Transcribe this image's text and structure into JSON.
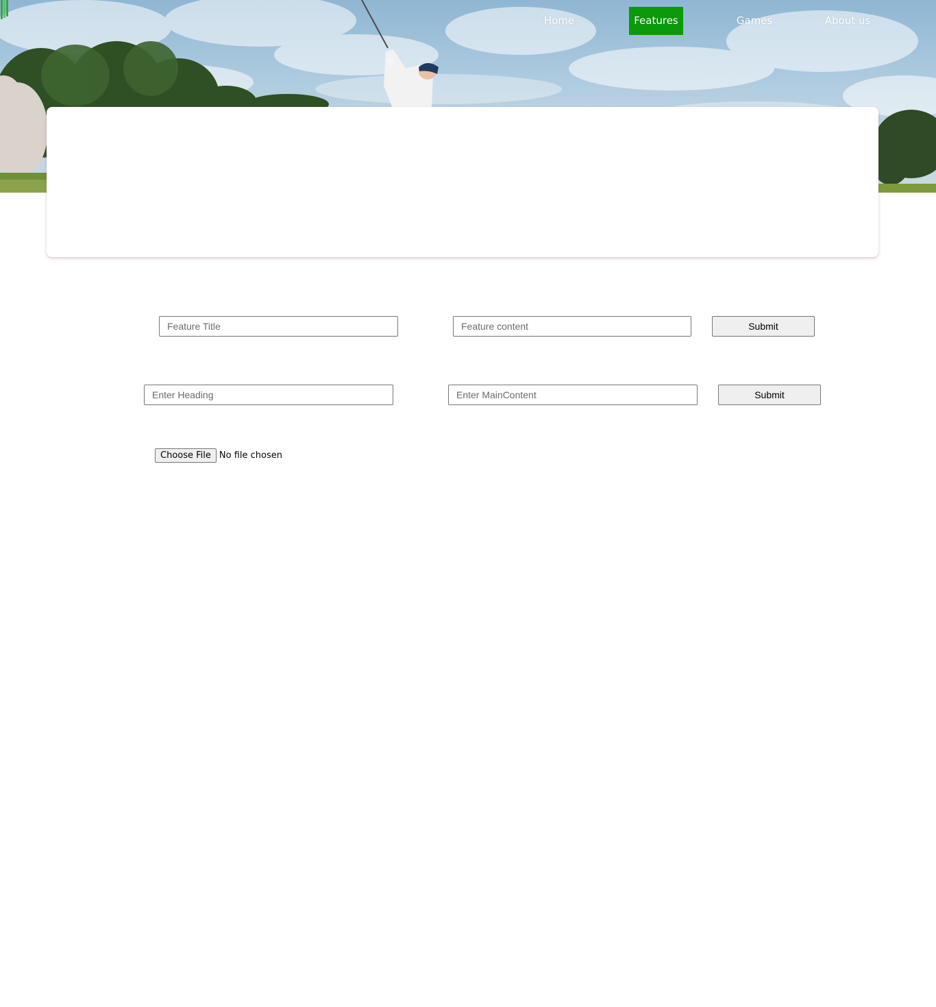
{
  "nav": {
    "items": [
      {
        "label": "Home",
        "active": false
      },
      {
        "label": "Features",
        "active": true
      },
      {
        "label": "Games",
        "active": false
      },
      {
        "label": "About us",
        "active": false
      }
    ]
  },
  "theme": {
    "accent": "#0a9a0a"
  },
  "feature_form": {
    "title_placeholder": "Feature Title",
    "content_placeholder": "Feature content",
    "submit_label": "Submit"
  },
  "content_form": {
    "heading_placeholder": "Enter Heading",
    "main_placeholder": "Enter MainContent",
    "submit_label": "Submit"
  },
  "file_upload": {
    "button_label": "Choose File",
    "status": "No file chosen"
  }
}
